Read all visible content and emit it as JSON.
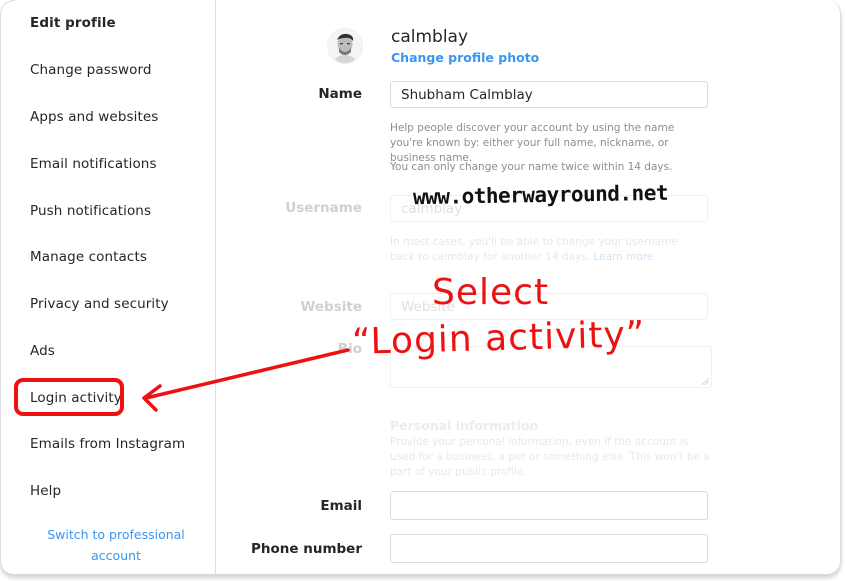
{
  "sidebar": {
    "items": [
      {
        "label": "Edit profile",
        "active": true
      },
      {
        "label": "Change password"
      },
      {
        "label": "Apps and websites"
      },
      {
        "label": "Email notifications"
      },
      {
        "label": "Push notifications"
      },
      {
        "label": "Manage contacts"
      },
      {
        "label": "Privacy and security"
      },
      {
        "label": "Ads"
      },
      {
        "label": "Login activity",
        "highlighted": true
      },
      {
        "label": "Emails from Instagram"
      },
      {
        "label": "Help"
      }
    ],
    "switch_professional": "Switch to professional account"
  },
  "profile": {
    "username": "calmblay",
    "change_photo": "Change profile photo",
    "avatar_icon": "user-avatar"
  },
  "form": {
    "name": {
      "label": "Name",
      "value": "Shubham Calmblay",
      "help1": "Help people discover your account by using the name you're known by: either your full name, nickname, or business name.",
      "help2": "You can only change your name twice within 14 days."
    },
    "username": {
      "label": "Username",
      "value": "calmblay",
      "help": "In most cases, you'll be able to change your username back to calmblay for another 14 days.",
      "learn_more": "Learn more"
    },
    "website": {
      "label": "Website",
      "placeholder": "Website"
    },
    "bio": {
      "label": "Bio",
      "value": ""
    },
    "personal_info": {
      "title": "Personal information",
      "help": "Provide your personal information, even if the account is used for a business, a pet or something else. This won't be a part of your public profile."
    },
    "email": {
      "label": "Email",
      "value": ""
    },
    "phone": {
      "label": "Phone number",
      "value": ""
    }
  },
  "annotations": {
    "watermark": "www.otherwayround.net",
    "line1": "Select",
    "line2": "“Login activity”",
    "color": "#ee1111"
  },
  "colors": {
    "link": "#3897f0",
    "text": "#262626",
    "border": "#dbdbdb"
  }
}
